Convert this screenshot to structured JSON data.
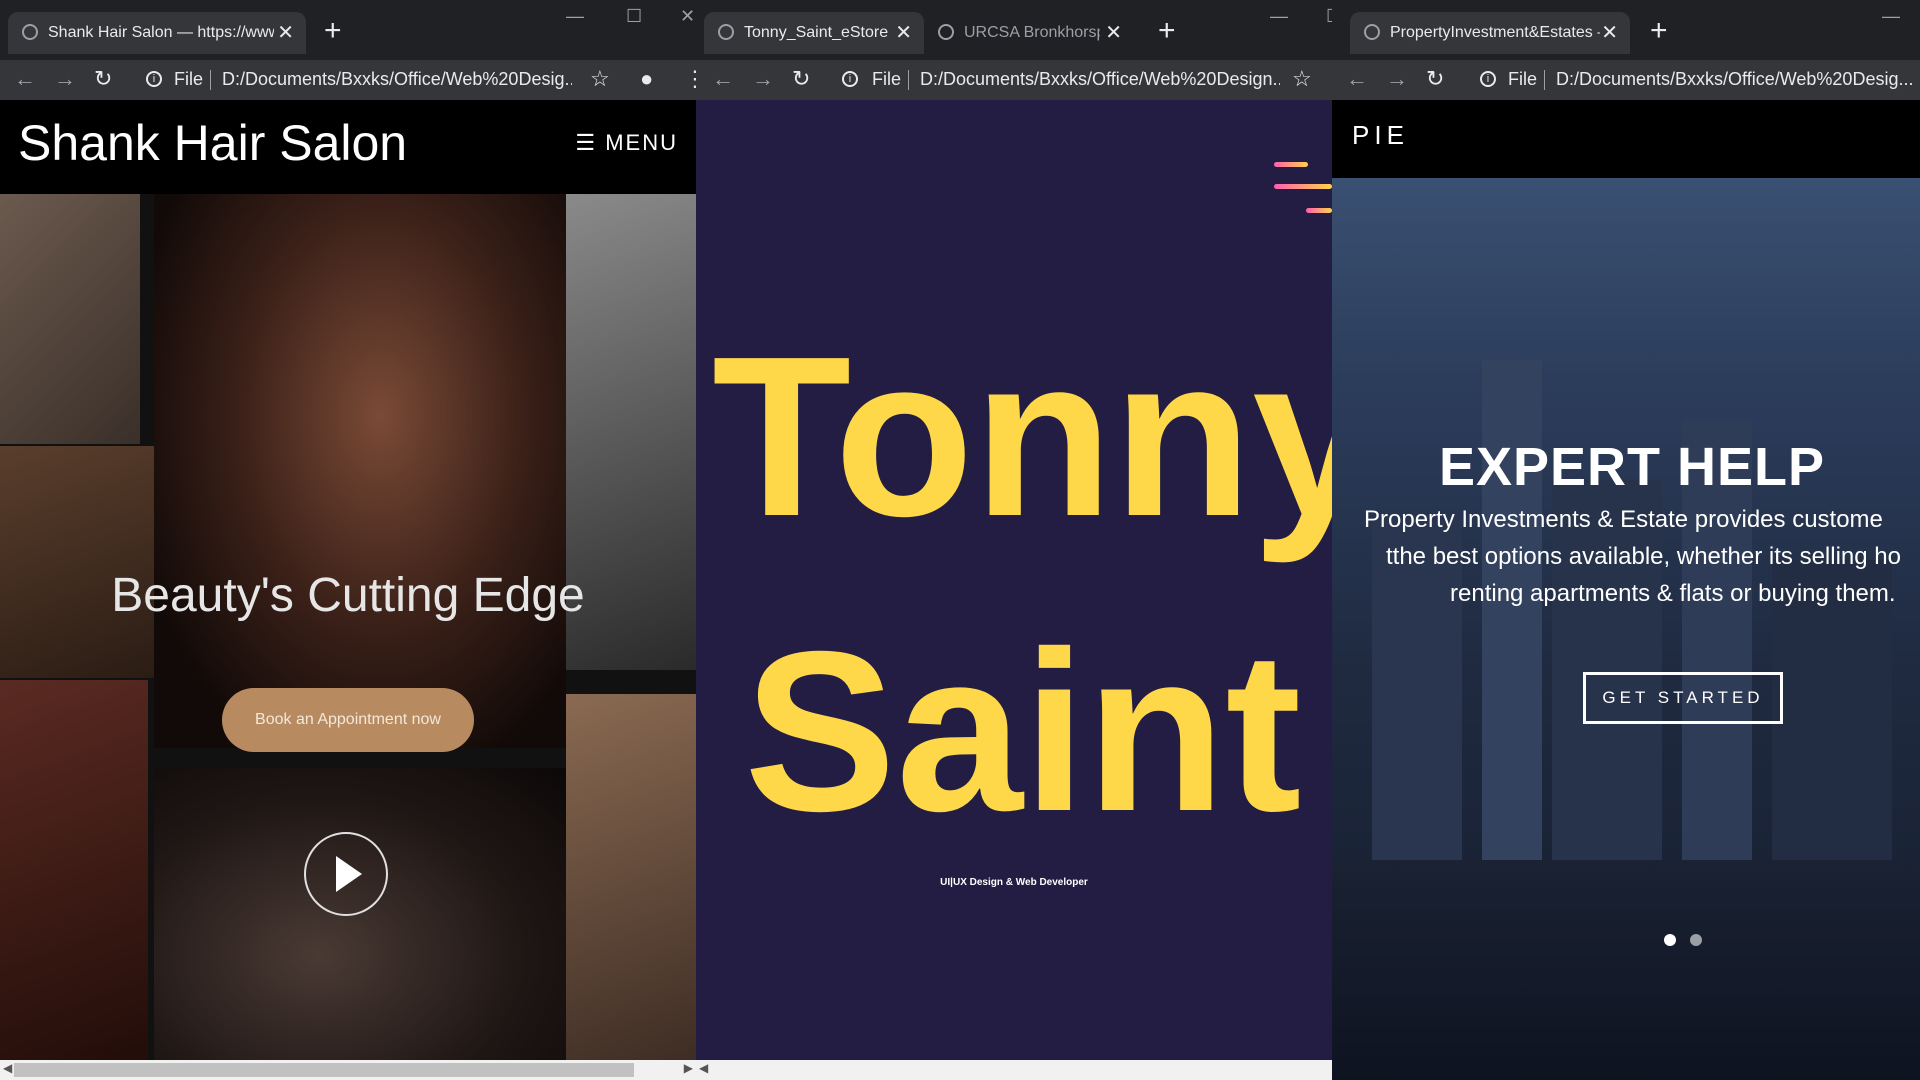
{
  "windows": [
    {
      "tabs": [
        {
          "title": "Shank Hair Salon — https://www",
          "close": "✕"
        }
      ],
      "new_tab": "+",
      "address": {
        "scheme_label": "File",
        "url": "D:/Documents/Bxxks/Office/Web%20Desig..."
      },
      "page": {
        "logo": "Shank Hair Salon",
        "menu_label": "☰ MENU",
        "hero_title": "Beauty's Cutting Edge",
        "book_button": "Book an Appointment now"
      }
    },
    {
      "tabs": [
        {
          "title": "Tonny_Saint_eStore",
          "close": "✕"
        },
        {
          "title": "URCSA Bronkhorspr",
          "close": "✕"
        }
      ],
      "new_tab": "+",
      "address": {
        "scheme_label": "File",
        "url": "D:/Documents/Bxxks/Office/Web%20Design..."
      },
      "page": {
        "name_line1": "Tonny",
        "name_line2": "Saint",
        "tagline": "UI|UX Design & Web Developer"
      }
    },
    {
      "tabs": [
        {
          "title": "PropertyInvestment&Estates —h",
          "close": "✕"
        }
      ],
      "new_tab": "+",
      "address": {
        "scheme_label": "File",
        "url": "D:/Documents/Bxxks/Office/Web%20Desig..."
      },
      "page": {
        "logo": "PIE",
        "hero_title": "EXPERT HELP",
        "hero_lines": [
          "Property Investments & Estate provides custome",
          "tthe best options available, whether its selling ho",
          "renting apartments & flats or buying them."
        ],
        "cta": "GET STARTED",
        "slide_count": 2,
        "active_slide": 1
      }
    }
  ],
  "colors": {
    "chrome_dark": "#202124",
    "chrome_tab": "#35363a",
    "tonny_bg": "#231d43",
    "gradient_pink": "#ff5fb0",
    "gradient_yellow": "#ffd24a",
    "book_button": "#b88a5f"
  },
  "icons": [
    "back-icon",
    "forward-icon",
    "reload-icon",
    "info-icon",
    "star-icon",
    "profile-icon",
    "kebab-menu-icon",
    "globe-icon",
    "close-icon",
    "play-icon",
    "hamburger-icon"
  ]
}
